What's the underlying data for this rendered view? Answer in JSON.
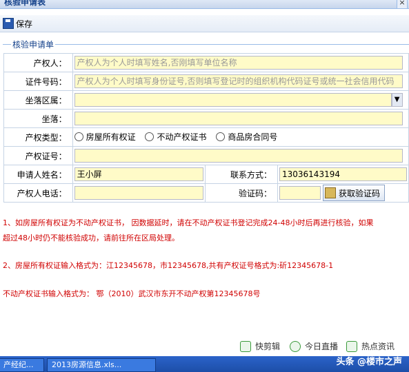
{
  "window": {
    "title": "核验申请表",
    "close_label": "×"
  },
  "toolbar": {
    "save_label": "保存"
  },
  "section": {
    "legend": "核验申请单"
  },
  "form": {
    "owner_label": "产权人：",
    "owner_placeholder": "产权人为个人时填写姓名,否刚填写单位名称",
    "id_label": "证件号码：",
    "id_placeholder": "产权人为个人时填写身份证号,否则填写登记时的组织机构代码证号或统一社会信用代码",
    "district_label": "坐落区属：",
    "address_label": "坐落：",
    "type_label": "产权类型：",
    "type_options": [
      "房屋所有权证",
      "不动产权证书",
      "商品房合同号"
    ],
    "cert_label": "产权证号：",
    "applicant_label": "申请人姓名：",
    "applicant_value": "王小屏",
    "contact_label": "联系方式：",
    "contact_value": "13036143194",
    "phone_label": "产权人电话：",
    "code_label": "验证码：",
    "get_code_label": "获取验证码"
  },
  "notes": {
    "line1": "1、如房屋所有权证为不动产权证书， 因数据延时，请在不动产权证书登记完成24-48小时后再进行核验，如果",
    "line2": "超过48小时仍不能核验成功，请前往所在区局处理。",
    "line3": "2、房屋所有权证输入格式为：江12345678，市12345678,共有产权证号格式为:斫12345678-1",
    "line4": "不动产权证书输入格式为： 鄂（2010）武汉市东开不动产权第12345678号"
  },
  "bottom_links": [
    "快剪辑",
    "今日直播",
    "热点资讯"
  ],
  "taskbar": {
    "task1": "产经纪...",
    "task2": "2013房源信息.xls...",
    "brand": "头条 @楼市之声"
  }
}
